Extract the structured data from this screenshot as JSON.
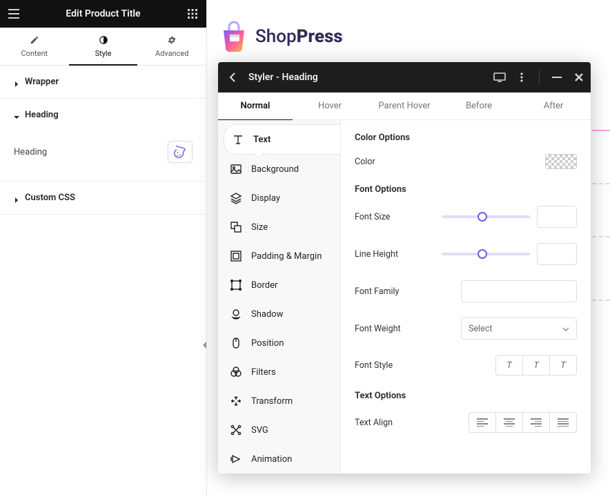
{
  "editor": {
    "title": "Edit Product Title",
    "tabs": {
      "content": "Content",
      "style": "Style",
      "advanced": "Advanced"
    },
    "sections": {
      "wrapper": "Wrapper",
      "heading": "Heading",
      "heading_item": "Heading",
      "custom_css": "Custom CSS"
    }
  },
  "brand": {
    "name_a": "Shop",
    "name_b": "Press"
  },
  "styler": {
    "title": "Styler - Heading",
    "states": {
      "normal": "Normal",
      "hover": "Hover",
      "parent_hover": "Parent Hover",
      "before": "Before",
      "after": "After"
    },
    "cats": {
      "text": "Text",
      "background": "Background",
      "display": "Display",
      "size": "Size",
      "padding_margin": "Padding & Margin",
      "border": "Border",
      "shadow": "Shadow",
      "position": "Position",
      "filters": "Filters",
      "transform": "Transform",
      "svg": "SVG",
      "animation": "Animation"
    },
    "groups": {
      "color_options": "Color Options",
      "font_options": "Font Options",
      "text_options": "Text Options"
    },
    "labels": {
      "color": "Color",
      "font_size": "Font Size",
      "line_height": "Line Height",
      "font_family": "Font Family",
      "font_weight": "Font Weight",
      "font_style": "Font Style",
      "text_align": "Text Align"
    },
    "font_weight_placeholder": "Select",
    "font_style_btns": {
      "a": "T",
      "b": "T",
      "c": "T"
    }
  }
}
